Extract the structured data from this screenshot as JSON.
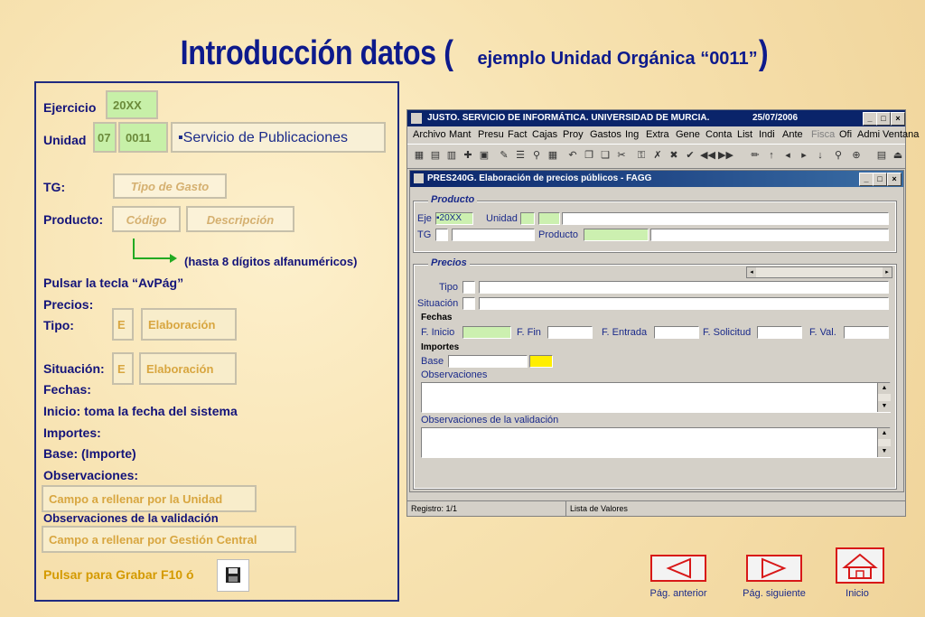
{
  "title": {
    "main": "Introducción datos (",
    "sub": "ejemplo Unidad Orgánica “0011”",
    "close": ")"
  },
  "left": {
    "ejercicio_label": "Ejercicio",
    "ejercicio_value": "20XX",
    "unidad_label": "Unidad",
    "unidad_value1": "07",
    "unidad_value2": "0011",
    "servicio": "▪Servicio de Publicaciones",
    "tg_label": "TG:",
    "tg_box": "Tipo de Gasto",
    "producto_label": "Producto:",
    "codigo_box": "Código",
    "descripcion_box": "Descripción",
    "hasta_note": "(hasta 8 dígitos alfanuméricos)",
    "pulsar_avpag": "Pulsar la tecla “AvPág”",
    "precios_label": "Precios:",
    "tipo_label": "Tipo:",
    "tipo_code": "E",
    "tipo_value": "Elaboración",
    "situacion_label": "Situación:",
    "situacion_code": "E",
    "situacion_value": "Elaboración",
    "fechas_label": "Fechas:",
    "inicio_label": "Inicio: toma la fecha del sistema",
    "importes_label": "Importes:",
    "base_label": "Base: (Importe)",
    "observaciones_label": "Observaciones:",
    "obs_box": "Campo a rellenar por la Unidad",
    "obs_valid_label": "Observaciones de la validación",
    "obs_valid_box": "Campo a rellenar por Gestión Central",
    "grabar_label": "Pulsar  para Grabar F10 ó"
  },
  "app": {
    "title": "JUSTO. SERVICIO DE INFORMÁTICA. UNIVERSIDAD DE MURCIA.",
    "date": "25/07/2006",
    "menu": [
      "Archivo",
      "Mant",
      "Presu",
      "Fact",
      "Cajas",
      "Proy",
      "Gastos",
      "Ing",
      "Extra",
      "Gene",
      "Conta",
      "List",
      "Indi",
      "Ante",
      "Fisca",
      "Ofi",
      "Admi",
      "Ventana"
    ],
    "inner_title": "PRES240G. Elaboración de precios públicos - FAGG",
    "producto_group": "Producto",
    "eje_label": "Eje",
    "eje_value": "▪20XX",
    "unidad_label": "Unidad",
    "tg_label": "TG",
    "producto_label": "Producto",
    "precios_group": "Precios",
    "tipo_label": "Tipo",
    "situacion_label": "Situación",
    "fechas_label": "Fechas",
    "f_inicio": "F. Inicio",
    "f_fin": "F. Fin",
    "f_entrada": "F. Entrada",
    "f_solicitud": "F. Solicitud",
    "f_val": "F. Val.",
    "importes_label": "Importes",
    "base_label": "Base",
    "observaciones_label": "Observaciones",
    "obs_valid_label": "Observaciones de la validación",
    "registro": "Registro: 1/1",
    "lista_valores": "Lista de Valores"
  },
  "nav": {
    "anterior": "Pág. anterior",
    "siguiente": "Pág. siguiente",
    "inicio": "Inicio"
  }
}
